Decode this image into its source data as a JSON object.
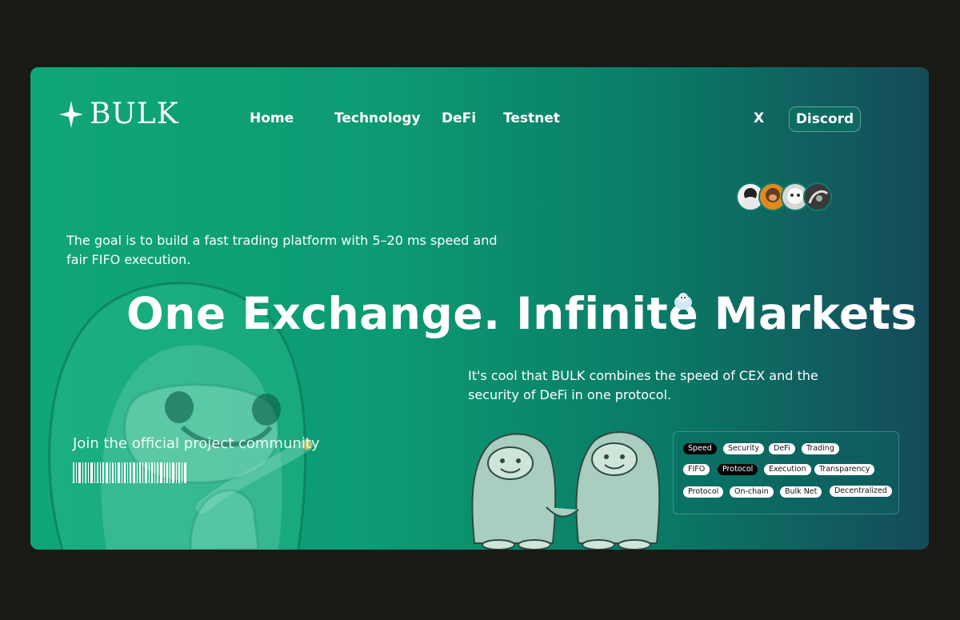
{
  "brand": {
    "name": "BULK"
  },
  "nav": {
    "items": [
      {
        "label": "Home"
      },
      {
        "label": "Technology"
      },
      {
        "label": "DeFi"
      },
      {
        "label": "Testnet"
      }
    ]
  },
  "social": {
    "x_label": "X",
    "discord_label": "Discord"
  },
  "hero": {
    "goal_text": "The goal is to build a fast trading platform with 5–20 ms speed and fair FIFO execution.",
    "headline": "One Exchange. Infinite Markets",
    "cool_text": "It's cool that BULK combines the speed of CEX and the security of DeFi in one protocol.",
    "join_text": "Join the official project community"
  },
  "tags": [
    {
      "label": "Speed",
      "style": "dark"
    },
    {
      "label": "Security",
      "style": "light"
    },
    {
      "label": "DeFi",
      "style": "light"
    },
    {
      "label": "Trading",
      "style": "light"
    },
    {
      "label": "FIFO",
      "style": "light"
    },
    {
      "label": "Protocol",
      "style": "dark"
    },
    {
      "label": "Execution",
      "style": "light"
    },
    {
      "label": "Transparency",
      "style": "light"
    },
    {
      "label": "Protocol",
      "style": "light"
    },
    {
      "label": "On-chain",
      "style": "light"
    },
    {
      "label": "Bulk Net",
      "style": "light"
    },
    {
      "label": "Decentralized",
      "style": "light"
    }
  ],
  "colors": {
    "page_background": "#1b1914",
    "gradient_start": "#10a678",
    "gradient_end": "#154b5a",
    "tag_dark": "#050505",
    "tag_light": "#ffffff"
  },
  "icons": [
    "sparkle-star-icon",
    "avatar-group",
    "barcode-icon",
    "yeti-illustration",
    "yeti-handshake-illustration"
  ]
}
